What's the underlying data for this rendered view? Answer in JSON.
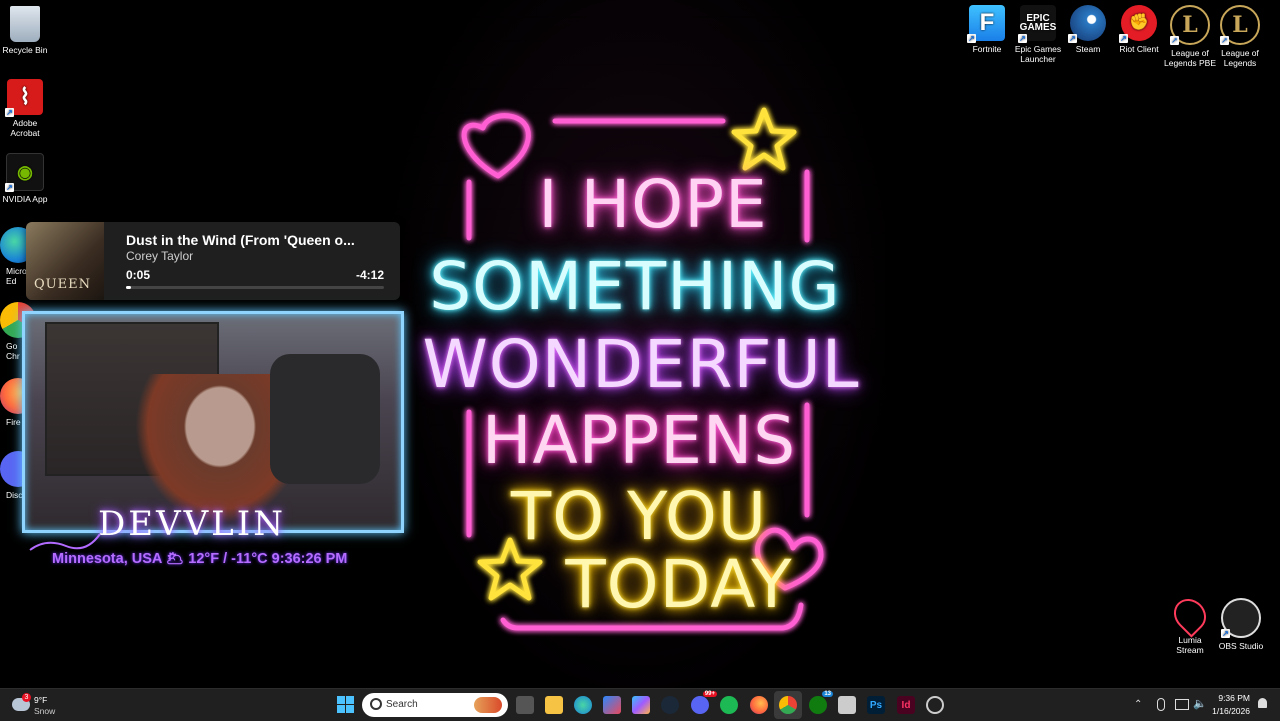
{
  "desktop_icons_left": [
    {
      "label": "Recycle Bin",
      "icon": "recycle-bin-icon"
    },
    {
      "label": "Adobe Acrobat",
      "icon": "acrobat-icon"
    },
    {
      "label": "NVIDIA App",
      "icon": "nvidia-icon"
    },
    {
      "label": "Micro Ed",
      "icon": "edge-icon"
    },
    {
      "label": "Go Chr",
      "icon": "chrome-icon"
    },
    {
      "label": "Fire",
      "icon": "firefox-icon"
    },
    {
      "label": "Disc",
      "icon": "discord-icon"
    }
  ],
  "desktop_icons_right": [
    {
      "label": "Fortnite",
      "icon": "fortnite-icon",
      "glyph": "F"
    },
    {
      "label": "Epic Games Launcher",
      "icon": "epic-games-icon",
      "glyph": "EPIC\nGAMES"
    },
    {
      "label": "Steam",
      "icon": "steam-icon",
      "glyph": ""
    },
    {
      "label": "Riot Client",
      "icon": "riot-client-icon",
      "glyph": ""
    },
    {
      "label": "League of Legends PBE",
      "icon": "league-pbe-icon",
      "glyph": "L"
    },
    {
      "label": "League of Legends",
      "icon": "league-icon",
      "glyph": "L"
    }
  ],
  "desktop_icons_bottom_right": [
    {
      "label": "Lumia Stream",
      "icon": "lumia-stream-icon"
    },
    {
      "label": "OBS Studio",
      "icon": "obs-studio-icon"
    }
  ],
  "media_player": {
    "title": "Dust in the Wind (From 'Queen o...",
    "artist": "Corey Taylor",
    "elapsed": "0:05",
    "remaining": "-4:12",
    "progress": 0.02,
    "album_text": "QUEEN"
  },
  "stream_overlay": {
    "name": "DEVVLIN",
    "info": "Minnesota, USA  🌥  12°F / -11°C  9:36:26 PM"
  },
  "neon_sign": {
    "lines": [
      "I HOPE",
      "SOMETHING",
      "WONDERFUL",
      "HAPPENS",
      "TO YOU",
      "TODAY"
    ],
    "colors": [
      "#ff5fd2",
      "#6ff6ff",
      "#e97bff",
      "#ff6ad5",
      "#ffe23a",
      "#ffe23a"
    ]
  },
  "taskbar": {
    "weather_temp": "9°F",
    "weather_desc": "Snow",
    "weather_badge": "3",
    "search_placeholder": "Search",
    "time": "9:36 PM",
    "date": "1/16/2026",
    "discord_badge": "99+",
    "xbox_badge": "13"
  }
}
